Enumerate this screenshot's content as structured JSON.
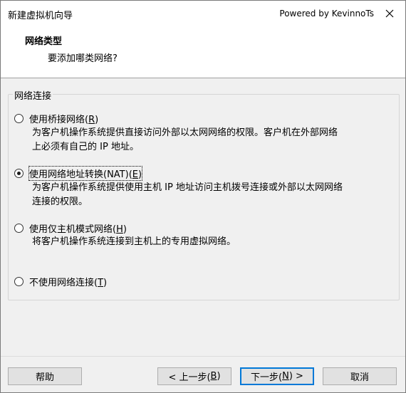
{
  "window": {
    "title": "新建虚拟机向导",
    "powered_by": "Powered by KevinnoTs"
  },
  "header": {
    "title": "网络类型",
    "subtitle": "要添加哪类网络?"
  },
  "group": {
    "legend": "网络连接"
  },
  "options": [
    {
      "label_pre": "使用桥接网络(",
      "mnemonic": "R",
      "label_post": ")",
      "selected": false,
      "desc_line1": "为客户机操作系统提供直接访问外部以太网网络的权限。客户机在外部网络",
      "desc_line2": "上必须有自己的 IP 地址。"
    },
    {
      "label_pre": "使用网络地址转换(NAT)(",
      "mnemonic": "E",
      "label_post": ")",
      "selected": true,
      "desc_line1": "为客户机操作系统提供使用主机 IP 地址访问主机拨号连接或外部以太网网络",
      "desc_line2": "连接的权限。"
    },
    {
      "label_pre": "使用仅主机模式网络(",
      "mnemonic": "H",
      "label_post": ")",
      "selected": false,
      "desc_line1": "将客户机操作系统连接到主机上的专用虚拟网络。"
    },
    {
      "label_pre": "不使用网络连接(",
      "mnemonic": "T",
      "label_post": ")",
      "selected": false
    }
  ],
  "buttons": {
    "help": "帮助",
    "back_pre": "< 上一步(",
    "back_mn": "B",
    "back_post": ")",
    "next_pre": "下一步(",
    "next_mn": "N",
    "next_post": ") >",
    "cancel": "取消"
  },
  "icons": {
    "close": "close-icon"
  }
}
